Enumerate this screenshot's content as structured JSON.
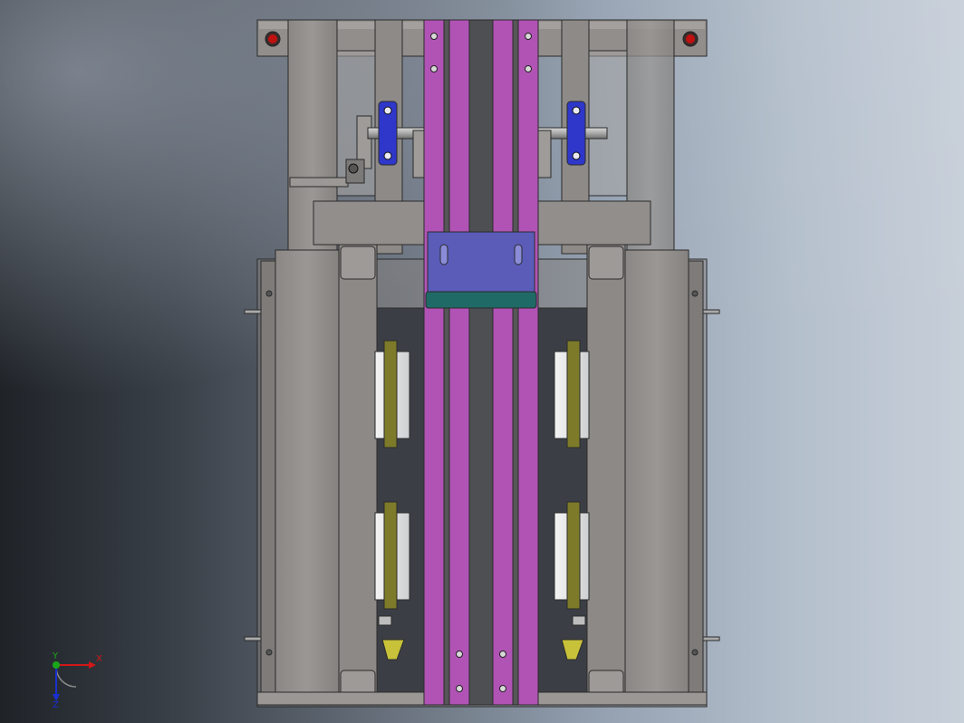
{
  "view": {
    "background": "gradient-dark-to-light",
    "colors": {
      "frame_gray": "#8f8c89",
      "frame_stroke": "#2b2b2b",
      "rail_magenta": "#b153b5",
      "bracket_blue": "#5a5cb8",
      "bar_teal": "#1f6a66",
      "block_blue": "#2e37c9",
      "pad_olive": "#7d7a2a",
      "wedge_yellow": "#c8c23a",
      "stop_red": "#c01010"
    }
  },
  "triad": {
    "x_label": "X",
    "y_label": "Y",
    "z_label": "Z",
    "x_color": "#d01818",
    "y_color": "#1aa81a",
    "z_color": "#1a2fd0"
  }
}
